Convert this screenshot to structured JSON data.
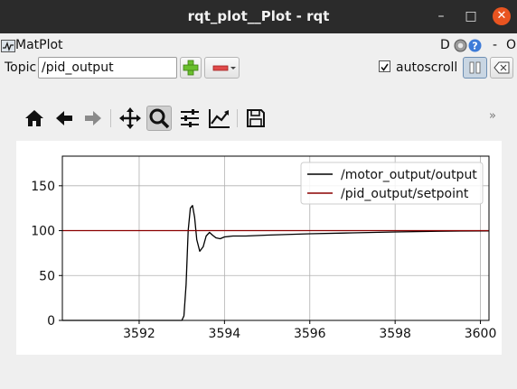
{
  "window": {
    "title": "rqt_plot__Plot - rqt",
    "minimize": "–",
    "maximize": "□",
    "close": "✕"
  },
  "plugin": {
    "name": "MatPlot",
    "d_label": "D",
    "o_label": "O",
    "dash_label": "-"
  },
  "topic_bar": {
    "label": "Topic",
    "value": "/pid_output",
    "autoscroll_label": "autoscroll",
    "autoscroll_checked": true
  },
  "toolbar": {
    "icons": [
      "home-icon",
      "back-arrow-icon",
      "forward-arrow-icon",
      "pan-icon",
      "zoom-icon",
      "subplots-icon",
      "edit-axis-icon",
      "save-icon"
    ],
    "overflow": "»"
  },
  "chart_data": {
    "type": "line",
    "xlim": [
      3590.2,
      3600.2
    ],
    "ylim": [
      0,
      183
    ],
    "xticks": [
      3592,
      3594,
      3596,
      3598,
      3600
    ],
    "yticks": [
      0,
      50,
      100,
      150
    ],
    "grid": true,
    "legend_position": "top-right",
    "series": [
      {
        "name": "/motor_output/output",
        "color": "#000000",
        "x": [
          3590.2,
          3592.0,
          3593.0,
          3593.05,
          3593.1,
          3593.15,
          3593.2,
          3593.25,
          3593.3,
          3593.35,
          3593.42,
          3593.5,
          3593.57,
          3593.65,
          3593.72,
          3593.8,
          3593.9,
          3594.0,
          3594.2,
          3594.5,
          3595.0,
          3596.0,
          3597.0,
          3598.0,
          3599.0,
          3600.2
        ],
        "y": [
          0,
          0,
          0,
          5,
          40,
          100,
          125,
          128,
          115,
          90,
          77,
          82,
          94,
          98,
          95,
          92,
          91,
          93,
          94,
          94,
          95,
          96.5,
          97.5,
          98.5,
          99.3,
          99.7
        ]
      },
      {
        "name": "/pid_output/setpoint",
        "color": "#8b0000",
        "x": [
          3590.2,
          3600.2
        ],
        "y": [
          100,
          100
        ]
      }
    ]
  }
}
